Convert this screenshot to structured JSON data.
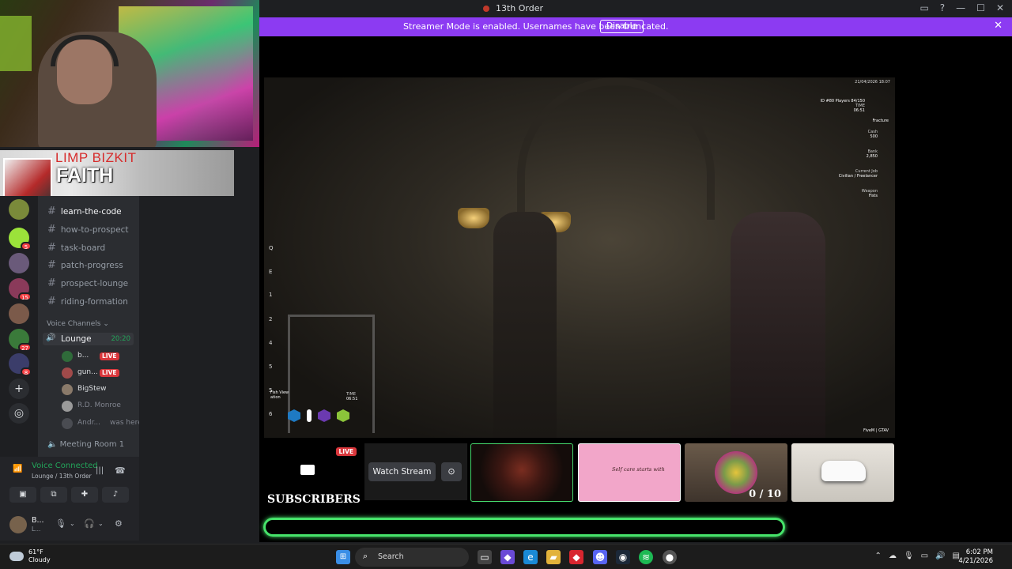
{
  "window": {
    "title": "13th Order"
  },
  "banner": {
    "message": "Streamer Mode is enabled. Usernames have been truncated.",
    "disable_label": "Disable"
  },
  "now_playing": {
    "artist": "LIMP BIZKIT",
    "song": "FAITH"
  },
  "servers": [
    {
      "badge": ""
    },
    {
      "badge": "5"
    },
    {
      "badge": ""
    },
    {
      "badge": "15"
    },
    {
      "badge": ""
    },
    {
      "badge": "27"
    },
    {
      "badge": "8"
    }
  ],
  "channels": {
    "text": [
      "learn-the-code",
      "how-to-prospect",
      "task-board",
      "patch-progress",
      "prospect-lounge",
      "riding-formation"
    ],
    "voice_header": "Voice Channels",
    "lounge": {
      "name": "Lounge",
      "time": "20:20"
    },
    "voice_users": [
      {
        "name": "b...",
        "live": "LIVE"
      },
      {
        "name": "gun...",
        "live": "LIVE"
      },
      {
        "name": "BigStew",
        "live": ""
      },
      {
        "name": "R.D. Monroe",
        "live": ""
      },
      {
        "name": "Andr...",
        "note": "was here"
      }
    ],
    "meeting_room": "Meeting Room 1"
  },
  "voice_panel": {
    "status": "Voice Connected",
    "location": "Lounge / 13th Order",
    "username": "B...",
    "usertag": "L..."
  },
  "game_hud": {
    "date": "21/04/2026 18:07",
    "id": "ID #80",
    "players": "Players 84/150",
    "time_label": "TIME",
    "time": "06:51",
    "fracture": "Fracture",
    "cash_label": "Cash",
    "cash": "500",
    "bank_label": "Bank",
    "bank": "2,850",
    "job_label": "Current Job",
    "job": "Civilian / Freelancer",
    "weapon_label": "Weapon",
    "weapon": "Fists",
    "location": "Fish View",
    "location_sub": "ation",
    "keys": [
      "Q",
      "E",
      "1",
      "2",
      "4",
      "5",
      "5",
      "6"
    ],
    "watermark": "FiveM | GTAV"
  },
  "stream": {
    "live": "LIVE",
    "watch_label": "Watch Stream",
    "subscribers_label": "SUBSCRIBERS",
    "thumb2_text": "Self care starts with",
    "thumb3_count": "0 / 10",
    "progress_pct": 0
  },
  "taskbar": {
    "weather_temp": "61°F",
    "weather_desc": "Cloudy",
    "search_label": "Search",
    "time": "6:02 PM",
    "date": "4/21/2026"
  }
}
